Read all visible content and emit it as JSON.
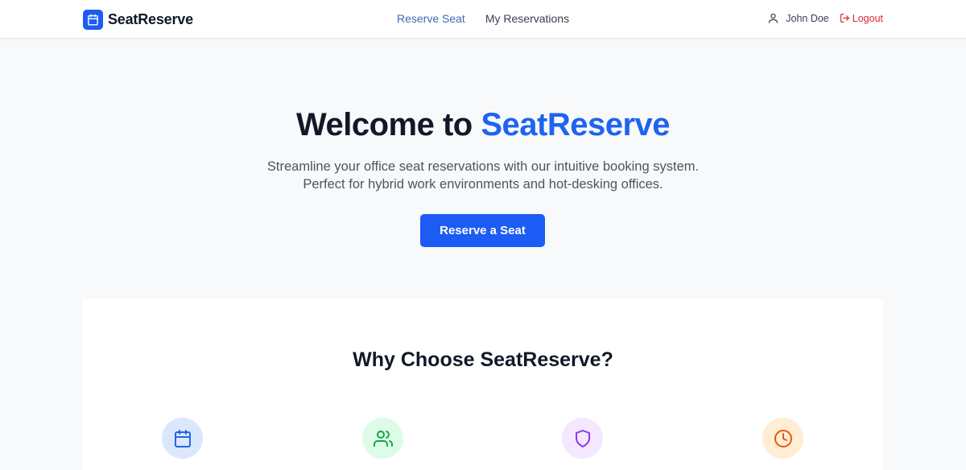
{
  "header": {
    "brand_name": "SeatReserve",
    "brand_icon": "calendar-icon",
    "nav": [
      {
        "label": "Reserve Seat",
        "active": true
      },
      {
        "label": "My Reservations",
        "active": false
      }
    ],
    "user_name": "John Doe",
    "logout_label": "Logout"
  },
  "hero": {
    "title_prefix": "Welcome to",
    "title_accent": "SeatReserve",
    "subtitle": "Streamline your office seat reservations with our intuitive booking system. Perfect for hybrid work environments and hot-desking offices.",
    "cta_label": "Reserve a Seat"
  },
  "features": {
    "title": "Why Choose SeatReserve?",
    "icons": [
      "calendar-icon",
      "users-icon",
      "shield-icon",
      "clock-icon"
    ]
  },
  "colors": {
    "primary": "#1c5cf5",
    "accent_text": "#1f63f0",
    "nav_active": "#3b6bb5",
    "logout": "#dc2626",
    "background": "#f8f9fb"
  }
}
